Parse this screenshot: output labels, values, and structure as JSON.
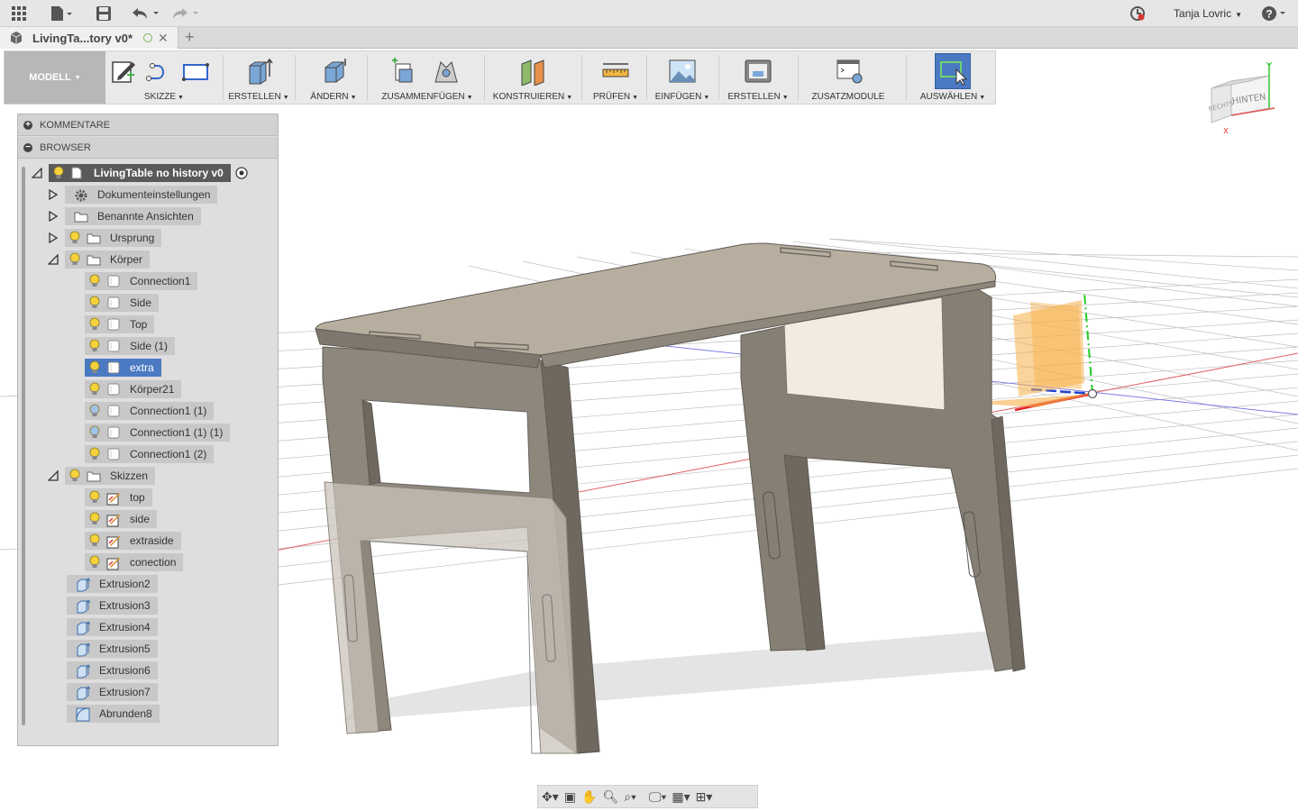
{
  "appbar": {
    "user_name": "Tanja Lovric"
  },
  "tab": {
    "title": "LivingTa...tory v0*"
  },
  "toolbar": {
    "mode": "MODELL",
    "groups": [
      {
        "label": "SKIZZE"
      },
      {
        "label": "ERSTELLEN"
      },
      {
        "label": "ÄNDERN"
      },
      {
        "label": "ZUSAMMENFÜGEN"
      },
      {
        "label": "KONSTRUIEREN"
      },
      {
        "label": "PRÜFEN"
      },
      {
        "label": "EINFÜGEN"
      },
      {
        "label": "ERSTELLEN"
      },
      {
        "label": "ZUSATZMODULE"
      },
      {
        "label": "AUSWÄHLEN"
      }
    ]
  },
  "panel": {
    "comments_label": "KOMMENTARE",
    "browser_label": "BROWSER",
    "root": "LivingTable no history v0",
    "items": [
      {
        "label": "Dokumenteinstellungen"
      },
      {
        "label": "Benannte Ansichten"
      },
      {
        "label": "Ursprung"
      },
      {
        "label": "Körper"
      },
      {
        "label": "Connection1"
      },
      {
        "label": "Side"
      },
      {
        "label": "Top"
      },
      {
        "label": "Side (1)"
      },
      {
        "label": "extra"
      },
      {
        "label": "Körper21"
      },
      {
        "label": "Connection1 (1)"
      },
      {
        "label": "Connection1 (1) (1)"
      },
      {
        "label": "Connection1 (2)"
      },
      {
        "label": "Skizzen"
      },
      {
        "label": "top"
      },
      {
        "label": "side"
      },
      {
        "label": "extraside"
      },
      {
        "label": "conection"
      },
      {
        "label": "Extrusion2"
      },
      {
        "label": "Extrusion3"
      },
      {
        "label": "Extrusion4"
      },
      {
        "label": "Extrusion5"
      },
      {
        "label": "Extrusion6"
      },
      {
        "label": "Extrusion7"
      },
      {
        "label": "Abrunden8"
      }
    ]
  },
  "viewcube": {
    "face_right": "HINTEN",
    "face_left": "RECHTS"
  },
  "colors": {
    "accent": "#4b7ac2",
    "wood": "#8e877b",
    "plane": "#f7b04a"
  }
}
